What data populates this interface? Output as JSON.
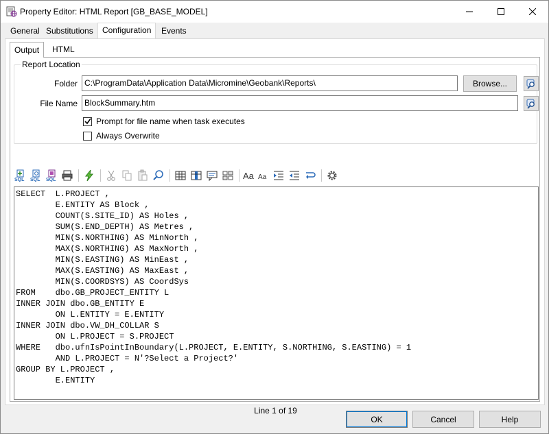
{
  "window": {
    "title": "Property Editor: HTML Report [GB_BASE_MODEL]",
    "controls": {
      "minimize": "—",
      "maximize": "☐",
      "close": "✕"
    }
  },
  "tabs": [
    "General",
    "Substitutions",
    "Configuration",
    "Events"
  ],
  "active_tab": "Configuration",
  "subtabs": [
    "Output",
    "HTML"
  ],
  "active_subtab": "Output",
  "report_location": {
    "group_label": "Report Location",
    "folder_label": "Folder",
    "folder_value": "C:\\ProgramData\\Application Data\\Micromine\\Geobank\\Reports\\",
    "browse_label": "Browse...",
    "filename_label": "File Name",
    "filename_value": "BlockSummary.htm",
    "prompt_label": "Prompt for file name when task executes",
    "prompt_checked": true,
    "overwrite_label": "Always Overwrite",
    "overwrite_checked": false
  },
  "toolbar": {
    "icons": [
      "sql-add-icon",
      "sql-check-icon",
      "sql-run-icon",
      "print-icon",
      "lightning-icon",
      "cut-icon",
      "copy-icon",
      "paste-icon",
      "find-icon",
      "table-icon",
      "columns-icon",
      "comment-icon",
      "grid-icon",
      "font-case-large-icon",
      "font-case-small-icon",
      "indent-icon",
      "outdent-icon",
      "word-wrap-icon",
      "settings-gear-icon"
    ]
  },
  "sql": {
    "code": "SELECT  L.PROJECT ,\n        E.ENTITY AS Block ,\n        COUNT(S.SITE_ID) AS Holes ,\n        SUM(S.END_DEPTH) AS Metres ,\n        MIN(S.NORTHING) AS MinNorth ,\n        MAX(S.NORTHING) AS MaxNorth ,\n        MIN(S.EASTING) AS MinEast ,\n        MAX(S.EASTING) AS MaxEast ,\n        MIN(S.COORDSYS) AS CoordSys\nFROM    dbo.GB_PROJECT_ENTITY L\nINNER JOIN dbo.GB_ENTITY E\n        ON L.ENTITY = E.ENTITY\nINNER JOIN dbo.VW_DH_COLLAR S\n        ON L.PROJECT = S.PROJECT\nWHERE   dbo.ufnIsPointInBoundary(L.PROJECT, E.ENTITY, S.NORTHING, S.EASTING) = 1\n        AND L.PROJECT = N'?Select a Project?'\nGROUP BY L.PROJECT ,\n        E.ENTITY"
  },
  "status": {
    "line_info": "Line 1 of 19"
  },
  "buttons": {
    "ok": "OK",
    "cancel": "Cancel",
    "help": "Help"
  }
}
